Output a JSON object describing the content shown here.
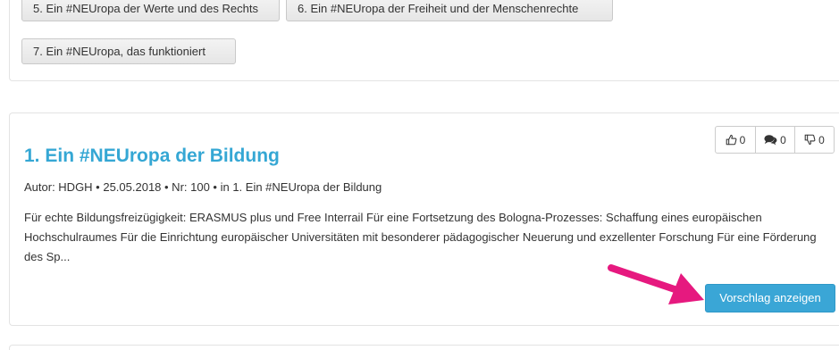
{
  "filters": {
    "categories": [
      "5. Ein #NEUropa der Werte und des Rechts",
      "6. Ein #NEUropa der Freiheit und der Menschenrechte",
      "7. Ein #NEUropa, das funktioniert"
    ]
  },
  "proposal": {
    "title": "1. Ein #NEUropa der Bildung",
    "meta": "Autor: HDGH • 25.05.2018 • Nr: 100 • in 1. Ein #NEUropa der Bildung",
    "excerpt": "Für echte Bildungsfreizügigkeit: ERASMUS plus und Free Interrail Für eine Fortsetzung des Bologna-Prozesses: Schaffung eines europäischen Hochschulraumes Für die Einrichtung europäischer Universitäten mit besonderer pädagogischer Neuerung und exzellenter Forschung Für eine Förderung des Sp...",
    "counters": {
      "likes": "0",
      "comments": "0",
      "dislikes": "0"
    },
    "show_button_label": "Vorschlag anzeigen"
  },
  "colors": {
    "link": "#35a7d4",
    "button": "#3aa6d6",
    "arrow": "#e6197f"
  },
  "icons": [
    "thumbs-up-icon",
    "comments-icon",
    "thumbs-down-icon"
  ]
}
